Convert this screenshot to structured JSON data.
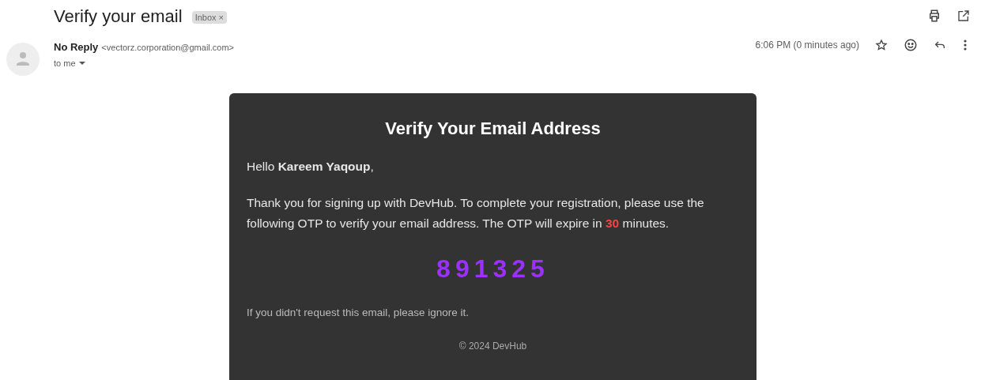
{
  "subject": "Verify your email",
  "label": {
    "text": "Inbox",
    "remove": "×"
  },
  "sender": {
    "name": "No Reply",
    "address": "<vectorz.corporation@gmail.com>",
    "recipient": "to me"
  },
  "time": "6:06 PM (0 minutes ago)",
  "starred": false,
  "email": {
    "title": "Verify Your Email Address",
    "greeting": "Hello **Kareem Yaqoup**,",
    "body": {
      "before": "Thank you for signing up with DevHub. To complete your registration, please use the following OTP to verify your email address. The OTP will expire in ",
      "highlight": "30",
      "after": " minutes."
    },
    "otp": "891325",
    "note": "If you didn't request this email, please ignore it.",
    "footer": "© 2024 DevHub"
  }
}
